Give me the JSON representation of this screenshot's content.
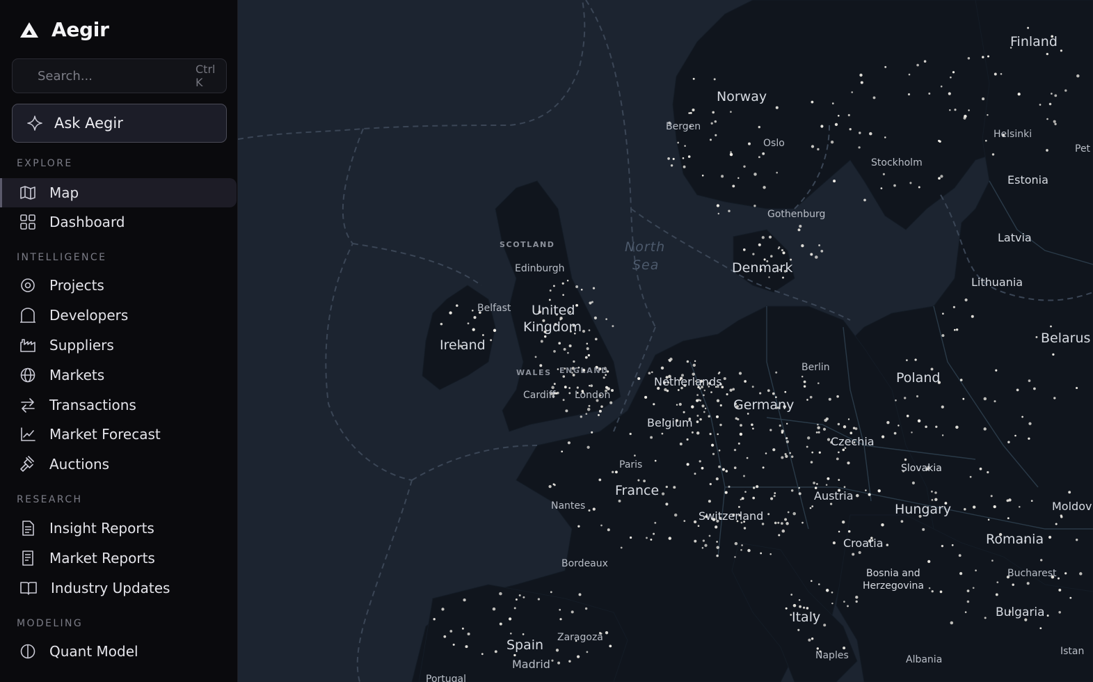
{
  "app": {
    "name": "Aegir"
  },
  "search": {
    "placeholder": "Search...",
    "shortcut": "Ctrl K"
  },
  "ask": {
    "label": "Ask Aegir"
  },
  "sections": {
    "explore": "EXPLORE",
    "intelligence": "INTELLIGENCE",
    "research": "RESEARCH",
    "modeling": "MODELING"
  },
  "nav": {
    "map": "Map",
    "dashboard": "Dashboard",
    "projects": "Projects",
    "developers": "Developers",
    "suppliers": "Suppliers",
    "markets": "Markets",
    "transactions": "Transactions",
    "market_forecast": "Market Forecast",
    "auctions": "Auctions",
    "insight_reports": "Insight Reports",
    "market_reports": "Market Reports",
    "industry_updates": "Industry Updates",
    "quant_model": "Quant Model"
  },
  "map_labels": {
    "finland": "Finland",
    "norway": "Norway",
    "bergen": "Bergen",
    "oslo": "Oslo",
    "stockholm": "Stockholm",
    "helsinki": "Helsinki",
    "pet": "Pet",
    "estonia": "Estonia",
    "latvia": "Latvia",
    "lithuania": "Lithuania",
    "belarus": "Belarus",
    "gothenburg": "Gothenburg",
    "north_sea_1": "North",
    "north_sea_2": "Sea",
    "denmark": "Denmark",
    "scotland": "SCOTLAND",
    "edinburgh": "Edinburgh",
    "belfast": "Belfast",
    "uk_1": "United",
    "uk_2": "Kingdom",
    "ireland": "Ireland",
    "wales": "WALES",
    "england": "ENGLAND",
    "cardiff": "Cardiff",
    "london": "London",
    "netherlands": "Netherlands",
    "berlin": "Berlin",
    "poland": "Poland",
    "germany": "Germany",
    "belgium": "Belgium",
    "czechia": "Czechia",
    "paris": "Paris",
    "france": "France",
    "slovakia": "Slovakia",
    "austria": "Austria",
    "nantes": "Nantes",
    "switzerland": "Switzerland",
    "hungary": "Hungary",
    "moldova": "Moldov",
    "croatia": "Croatia",
    "romania": "Romania",
    "bordeaux": "Bordeaux",
    "bosnia_1": "Bosnia and",
    "bosnia_2": "Herzegovina",
    "bucharest": "Bucharest",
    "bulgaria": "Bulgaria",
    "italy": "Italy",
    "spain": "Spain",
    "zaragoza": "Zaragoza",
    "madrid": "Madrid",
    "naples": "Naples",
    "albania": "Albania",
    "istanbul": "Istan",
    "portugal": "Portugal"
  },
  "colors": {
    "sidebar_bg": "#0a0a0d",
    "sea": "#1c2430",
    "land": "#10151d",
    "project_dot": "#f2efe8"
  }
}
